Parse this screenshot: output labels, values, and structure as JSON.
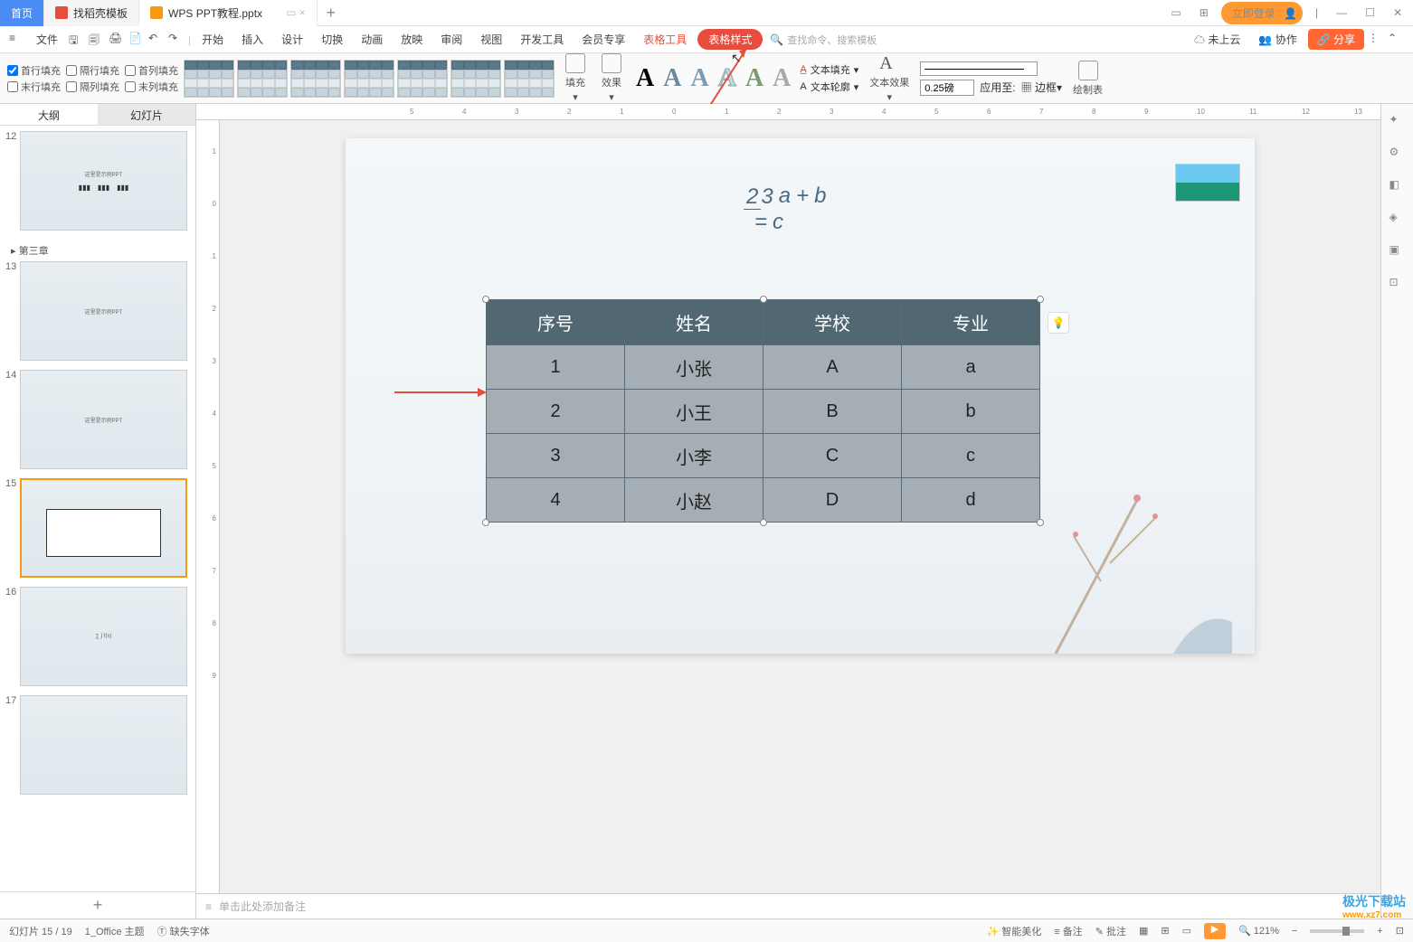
{
  "tabs": {
    "home": "首页",
    "docsite": "找稻壳模板",
    "filename": "WPS PPT教程.pptx"
  },
  "win": {
    "login": "立即登录"
  },
  "menu": {
    "file": "文件",
    "start": "开始",
    "insert": "插入",
    "design": "设计",
    "transition": "切换",
    "animation": "动画",
    "slideshow": "放映",
    "review": "审阅",
    "view": "视图",
    "devtools": "开发工具",
    "member": "会员专享",
    "tabletools": "表格工具",
    "tablestyle": "表格样式",
    "search_ph": "查找命令、搜索模板",
    "notcloud": "未上云",
    "coop": "协作",
    "share": "分享"
  },
  "ribbon": {
    "chk_firstrow": "首行填充",
    "chk_altrow": "隔行填充",
    "chk_firstcol": "首列填充",
    "chk_lastrow": "末行填充",
    "chk_altcol": "隔列填充",
    "chk_lastcol": "末列填充",
    "fill": "填充",
    "effect": "效果",
    "textfill": "文本填充",
    "textoutline": "文本轮廓",
    "texteffect": "文本效果",
    "pt": "0.25磅",
    "applyto": "应用至:",
    "border": "边框",
    "draw": "绘制表"
  },
  "thumbs": {
    "outline": "大纲",
    "slides": "幻灯片",
    "chapter": "第三章",
    "placeholder_title": "这里是示例PPT"
  },
  "slide": {
    "formula_a": "a",
    "formula_b": "b",
    "formula_c": "c",
    "formula_plus": "+",
    "formula_eq": "=",
    "frac_n": "2",
    "frac_d": "3",
    "headers": [
      "序号",
      "姓名",
      "学校",
      "专业"
    ],
    "rows": [
      [
        "1",
        "小张",
        "A",
        "a"
      ],
      [
        "2",
        "小王",
        "B",
        "b"
      ],
      [
        "3",
        "小李",
        "C",
        "c"
      ],
      [
        "4",
        "小赵",
        "D",
        "d"
      ]
    ]
  },
  "notes": {
    "placeholder": "单击此处添加备注"
  },
  "status": {
    "slidecount": "幻灯片 15 / 19",
    "theme": "1_Office 主题",
    "missingfont": "缺失字体",
    "smart": "智能美化",
    "beizhu": "备注",
    "pizhu": "批注",
    "zoom": "121%"
  },
  "watermark": {
    "line1": "极光下载站",
    "line2": "www.xz7.com"
  }
}
